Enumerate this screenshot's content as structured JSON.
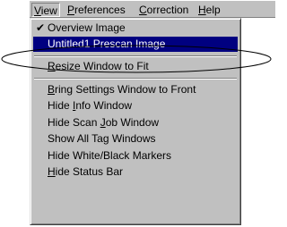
{
  "menubar": {
    "items": [
      {
        "pre": "",
        "ul": "V",
        "post": "iew"
      },
      {
        "pre": "",
        "ul": "P",
        "post": "references"
      },
      {
        "pre": "",
        "ul": "C",
        "post": "orrection"
      },
      {
        "pre": "",
        "ul": "H",
        "post": "elp"
      }
    ]
  },
  "view_menu": {
    "items": [
      {
        "pre": "",
        "ul": "",
        "post": "Overview Image",
        "checked": "✔"
      },
      {
        "pre": "",
        "ul": "",
        "post": "Untitled1 Prescan Image"
      },
      {
        "pre": "",
        "ul": "R",
        "post": "esize Window to Fit"
      },
      {
        "pre": "",
        "ul": "B",
        "post": "ring Settings Window to Front"
      },
      {
        "pre": "Hide ",
        "ul": "I",
        "post": "nfo Window"
      },
      {
        "pre": "Hide Scan ",
        "ul": "J",
        "post": "ob Window"
      },
      {
        "pre": "Show All Tag Windows",
        "ul": "",
        "post": ""
      },
      {
        "pre": "Hide White/Black Markers",
        "ul": "",
        "post": ""
      },
      {
        "pre": "",
        "ul": "H",
        "post": "ide Status Bar"
      }
    ]
  },
  "colors": {
    "menu_face": "#c0c0c0",
    "selection": "#000080",
    "selection_text": "#ffffff"
  }
}
